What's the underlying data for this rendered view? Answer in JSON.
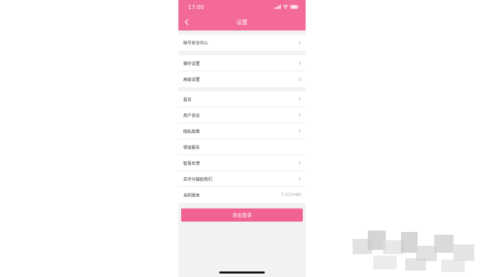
{
  "status_bar": {
    "time": "17:00",
    "icons": [
      "signal-icon",
      "wifi-icon",
      "battery-icon"
    ]
  },
  "nav": {
    "title": "设置",
    "back_icon": "chevron-left-icon"
  },
  "sections": [
    {
      "items": [
        {
          "label": "账号安全中心"
        }
      ]
    },
    {
      "items": [
        {
          "label": "操作设置"
        },
        {
          "label": "高级设置"
        }
      ]
    },
    {
      "items": [
        {
          "label": "投诉"
        },
        {
          "label": "用户协议"
        },
        {
          "label": "隐私政策"
        },
        {
          "label": "错误报告"
        },
        {
          "label": "智慧反馈"
        },
        {
          "label": "去评分鼓励我们"
        },
        {
          "label": "当前版本",
          "value": "5.5(1048)"
        }
      ]
    }
  ],
  "logout_label": "退出登录",
  "colors": {
    "accent": "#f36a96",
    "button": "#f06292",
    "background": "#f2f2f2"
  }
}
